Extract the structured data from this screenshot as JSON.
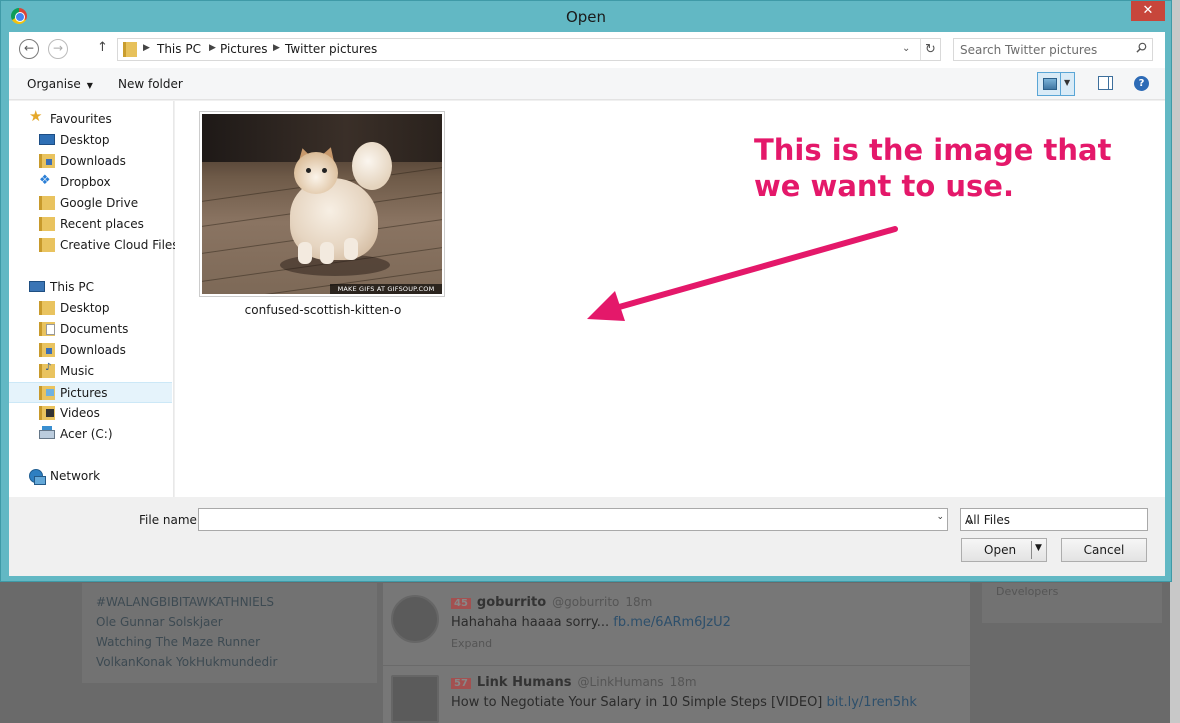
{
  "dialog": {
    "title": "Open",
    "close_glyph": "✕"
  },
  "navigation": {
    "back_glyph": "←",
    "forward_glyph": "→",
    "up_glyph": "↑",
    "breadcrumb": [
      "This PC",
      "Pictures",
      "Twitter pictures"
    ],
    "separator_glyph": "▶",
    "dropdown_glyph": "⌄",
    "refresh_glyph": "↻"
  },
  "search": {
    "placeholder": "Search Twitter pictures"
  },
  "toolbar": {
    "organise_label": "Organise",
    "caret_glyph": "▼",
    "new_folder_label": "New folder",
    "help_glyph": "?"
  },
  "sidebar": {
    "favourites": {
      "label": "Favourites",
      "items": [
        "Desktop",
        "Downloads",
        "Dropbox",
        "Google Drive",
        "Recent places",
        "Creative Cloud Files"
      ]
    },
    "this_pc": {
      "label": "This PC",
      "items": [
        "Desktop",
        "Documents",
        "Downloads",
        "Music",
        "Pictures",
        "Videos",
        "Acer (C:)"
      ],
      "selected": "Pictures"
    },
    "network": {
      "label": "Network"
    }
  },
  "content": {
    "files": [
      {
        "name": "confused-scottish-kitten-o",
        "watermark": "MAKE GIFS AT GIFSOUP.COM"
      }
    ]
  },
  "annotation": {
    "line1": "This is the image that",
    "line2": "we want to use.",
    "color": "#e4186a"
  },
  "footer": {
    "file_name_label": "File name:",
    "file_name_value": "",
    "filter_value": "All Files",
    "open_label": "Open",
    "cancel_label": "Cancel"
  },
  "background": {
    "trends": [
      "#WALANGBIBITAWKATHNIELS",
      "Ole Gunnar Solskjaer",
      "Watching The Maze Runner",
      "VolkanKonak YokHukmundedir"
    ],
    "developers_label": "Developers",
    "tweets": [
      {
        "badge": "45",
        "name": "goburrito",
        "handle": "@goburrito",
        "time": "18m",
        "text": "Hahahaha haaaa sorry... ",
        "link": "fb.me/6ARm6JzU2",
        "expand": "Expand"
      },
      {
        "badge": "57",
        "name": "Link Humans",
        "handle": "@LinkHumans",
        "time": "18m",
        "text": "How to Negotiate Your Salary in 10 Simple Steps [VIDEO] ",
        "link": "bit.ly/1ren5hk"
      }
    ]
  },
  "colors": {
    "window_frame": "#62b8c4",
    "close_button": "#c7463b",
    "selection": "#e5f3fb"
  }
}
